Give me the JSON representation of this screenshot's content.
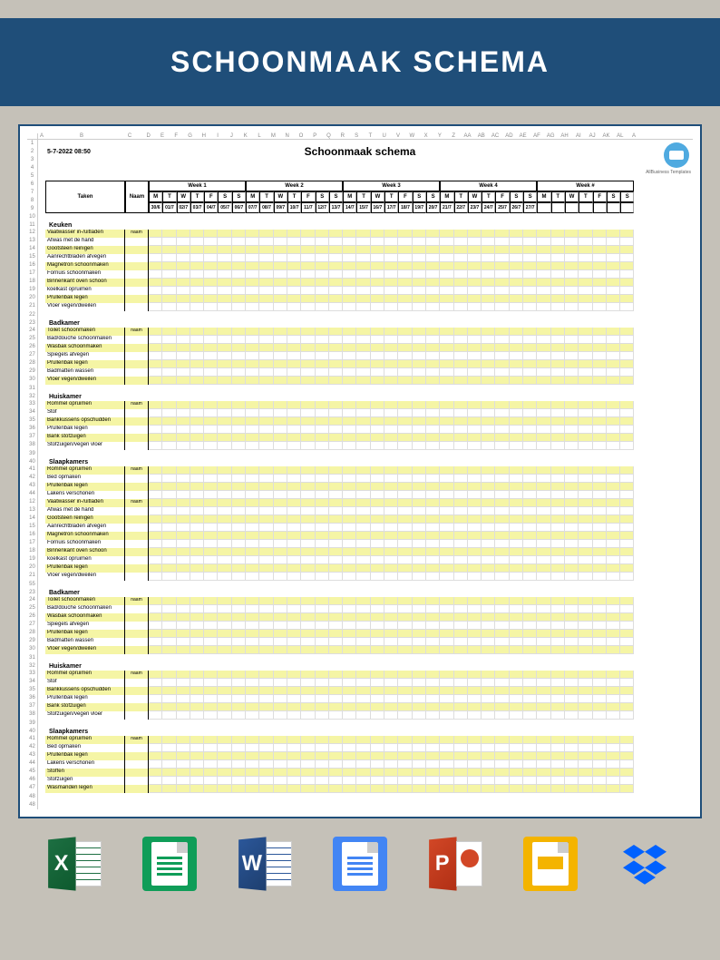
{
  "banner_title": "SCHOONMAAK SCHEMA",
  "timestamp": "5-7-2022 08:50",
  "sheet_title": "Schoonmaak schema",
  "logo_text": "AllBusiness Templates",
  "col_letters": [
    "A",
    "B",
    "C",
    "D",
    "E",
    "F",
    "G",
    "H",
    "I",
    "J",
    "K",
    "L",
    "M",
    "N",
    "O",
    "P",
    "Q",
    "R",
    "S",
    "T",
    "U",
    "V",
    "W",
    "X",
    "Y",
    "Z",
    "AA",
    "AB",
    "AC",
    "AD",
    "AE",
    "AF",
    "AG",
    "AH",
    "AI",
    "AJ",
    "AK",
    "AL",
    "A"
  ],
  "headers": {
    "taken": "Taken",
    "naam": "Naam"
  },
  "weeks": [
    "Week 1",
    "Week 2",
    "Week 3",
    "Week 4",
    "Week #"
  ],
  "days": [
    "M",
    "T",
    "W",
    "T",
    "F",
    "S",
    "S"
  ],
  "dates": [
    "30/6",
    "01/7",
    "02/7",
    "03/7",
    "04/7",
    "05/7",
    "06/7",
    "07/7",
    "08/7",
    "09/7",
    "10/7",
    "11/7",
    "12/7",
    "13/7",
    "14/7",
    "15/7",
    "16/7",
    "17/7",
    "18/7",
    "19/7",
    "20/7",
    "21/7",
    "22/7",
    "23/7",
    "24/7",
    "25/7",
    "26/7",
    "27/7",
    "",
    "",
    "",
    "",
    "",
    "",
    ""
  ],
  "naam_label": "naam",
  "sections": [
    {
      "row": 11,
      "title": "Keuken",
      "tasks": [
        {
          "r": 12,
          "t": "Vaatwasser in-/uitladen",
          "n": true
        },
        {
          "r": 13,
          "t": "Afwas met de hand"
        },
        {
          "r": 14,
          "t": "Gootsteen reinigen"
        },
        {
          "r": 15,
          "t": "Aanrechtbladen afvegen"
        },
        {
          "r": 16,
          "t": "Magnetron schoonmaken"
        },
        {
          "r": 17,
          "t": "Fornuis schoonmaken"
        },
        {
          "r": 18,
          "t": "Binnenkant oven schoon"
        },
        {
          "r": 19,
          "t": "koelkast opruimen"
        },
        {
          "r": 20,
          "t": "Prullenbak legen"
        },
        {
          "r": 21,
          "t": "Vloer vegen/dweilen"
        }
      ]
    },
    {
      "row": 23,
      "title": "Badkamer",
      "tasks": [
        {
          "r": 24,
          "t": "Toilet schoonmaken",
          "n": true
        },
        {
          "r": 25,
          "t": "Bad/douche schoonmaken"
        },
        {
          "r": 26,
          "t": "Wasbak schoonmaken"
        },
        {
          "r": 27,
          "t": "Spiegels afvegen"
        },
        {
          "r": 28,
          "t": "Prullenbak legen"
        },
        {
          "r": 29,
          "t": "Badmatten wassen"
        },
        {
          "r": 30,
          "t": "Vloer vegen/dweilen"
        }
      ]
    },
    {
      "row": 32,
      "title": "Huiskamer",
      "tasks": [
        {
          "r": 33,
          "t": "Rommel opruimen",
          "n": true
        },
        {
          "r": 34,
          "t": "Stof"
        },
        {
          "r": 35,
          "t": "Bankkussens opschudden"
        },
        {
          "r": 36,
          "t": "Prullenbak legen"
        },
        {
          "r": 37,
          "t": "Bank stofzuigen"
        },
        {
          "r": 38,
          "t": "Stofzuigen/vegen vloer"
        }
      ]
    },
    {
      "row": 40,
      "title": "Slaapkamers",
      "tasks": [
        {
          "r": 41,
          "t": "Rommel opruimen",
          "n": true
        },
        {
          "r": 42,
          "t": "Bed opmaken"
        },
        {
          "r": 43,
          "t": "Prullenbak legen"
        },
        {
          "r": 44,
          "t": "Lakens verschonen"
        },
        {
          "r": 12,
          "t": "Vaatwasser in-/uitladen",
          "n": true
        },
        {
          "r": 13,
          "t": "Afwas met de hand"
        },
        {
          "r": 14,
          "t": "Gootsteen reinigen"
        },
        {
          "r": 15,
          "t": "Aanrechtbladen afvegen"
        },
        {
          "r": 16,
          "t": "Magnetron schoonmaken"
        },
        {
          "r": 17,
          "t": "Fornuis schoonmaken"
        },
        {
          "r": 18,
          "t": "Binnenkant oven schoon"
        },
        {
          "r": 19,
          "t": "koelkast opruimen"
        },
        {
          "r": 20,
          "t": "Prullenbak legen"
        },
        {
          "r": 21,
          "t": "Vloer vegen/dweilen"
        }
      ]
    },
    {
      "row": 23,
      "title": "Badkamer",
      "tasks": [
        {
          "r": 24,
          "t": "Toilet schoonmaken",
          "n": true
        },
        {
          "r": 25,
          "t": "Bad/douche schoonmaken"
        },
        {
          "r": 26,
          "t": "Wasbak schoonmaken"
        },
        {
          "r": 27,
          "t": "Spiegels afvegen"
        },
        {
          "r": 28,
          "t": "Prullenbak legen"
        },
        {
          "r": 29,
          "t": "Badmatten wassen"
        },
        {
          "r": 30,
          "t": "Vloer vegen/dweilen"
        }
      ]
    },
    {
      "row": 32,
      "title": "Huiskamer",
      "tasks": [
        {
          "r": 33,
          "t": "Rommel opruimen",
          "n": true
        },
        {
          "r": 34,
          "t": "Stof"
        },
        {
          "r": 35,
          "t": "Bankkussens opschudden"
        },
        {
          "r": 36,
          "t": "Prullenbak legen"
        },
        {
          "r": 37,
          "t": "Bank stofzuigen"
        },
        {
          "r": 38,
          "t": "Stofzuigen/vegen vloer"
        }
      ]
    },
    {
      "row": 40,
      "title": "Slaapkamers",
      "tasks": [
        {
          "r": 41,
          "t": "Rommel opruimen",
          "n": true
        },
        {
          "r": 42,
          "t": "Bed opmaken"
        },
        {
          "r": 43,
          "t": "Prullenbak legen"
        },
        {
          "r": 44,
          "t": "Lakens verschonen"
        },
        {
          "r": 45,
          "t": "Stoffen"
        },
        {
          "r": 46,
          "t": "Stofzuigen"
        },
        {
          "r": 47,
          "t": "Wasmanden legen"
        }
      ]
    }
  ],
  "icons": [
    "excel",
    "google-sheets",
    "word",
    "google-docs",
    "powerpoint",
    "google-slides",
    "dropbox"
  ]
}
